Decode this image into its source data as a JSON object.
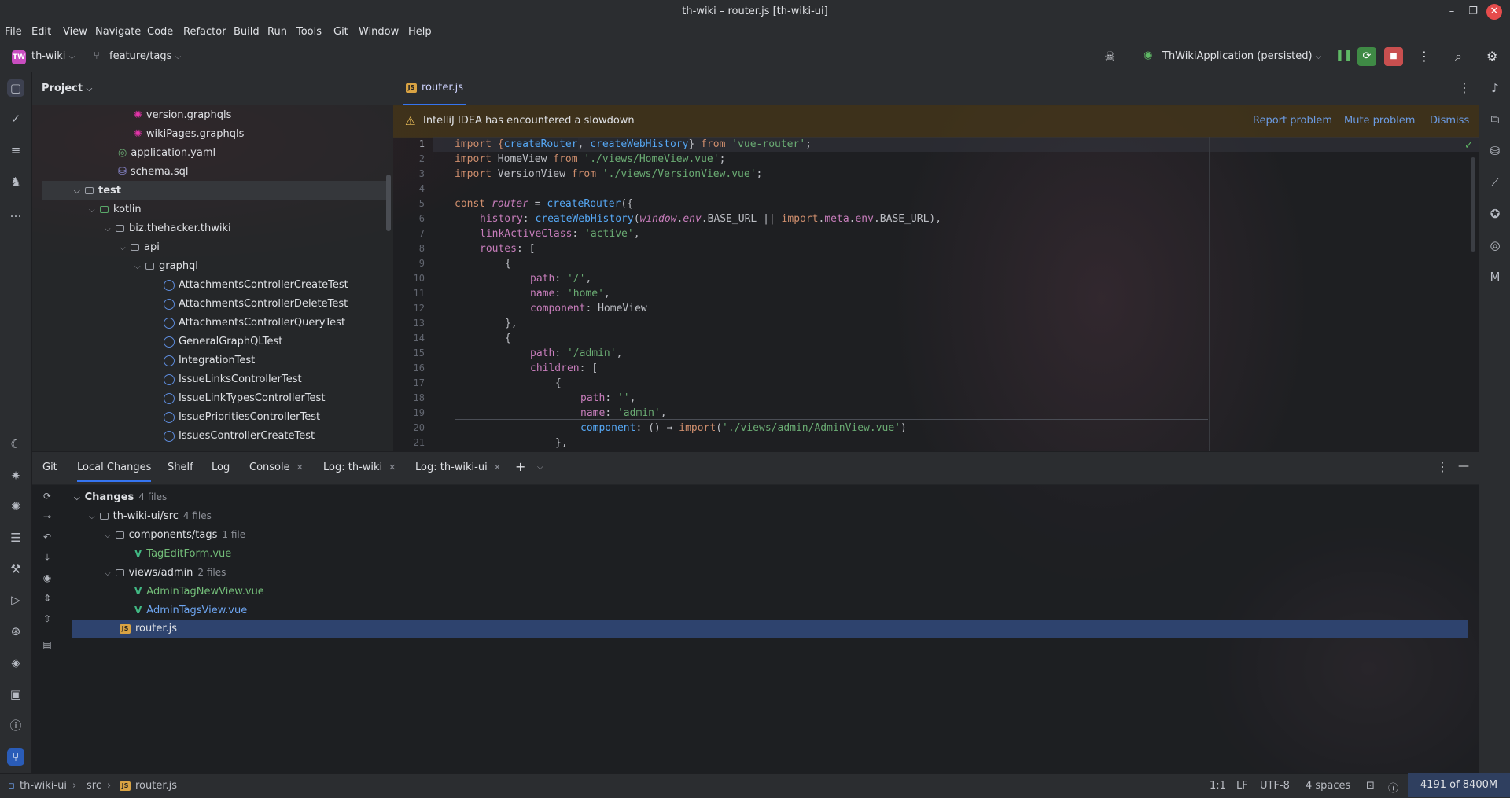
{
  "window": {
    "title": "th-wiki – router.js [th-wiki-ui]"
  },
  "menu": [
    "File",
    "Edit",
    "View",
    "Navigate",
    "Code",
    "Refactor",
    "Build",
    "Run",
    "Tools",
    "Git",
    "Window",
    "Help"
  ],
  "toolbar": {
    "project_badge": "TW",
    "project": "th-wiki",
    "branch": "feature/tags",
    "run_config": "ThWikiApplication (persisted)"
  },
  "project_panel": {
    "title": "Project",
    "tree": [
      {
        "label": "version.graphqls",
        "type": "graphql"
      },
      {
        "label": "wikiPages.graphqls",
        "type": "graphql"
      },
      {
        "label": "application.yaml",
        "type": "yaml"
      },
      {
        "label": "schema.sql",
        "type": "sql"
      },
      {
        "label": "test",
        "type": "folder"
      },
      {
        "label": "kotlin",
        "type": "folder-green"
      },
      {
        "label": "biz.thehacker.thwiki",
        "type": "package"
      },
      {
        "label": "api",
        "type": "package"
      },
      {
        "label": "graphql",
        "type": "package"
      },
      {
        "label": "AttachmentsControllerCreateTest",
        "type": "kotlin"
      },
      {
        "label": "AttachmentsControllerDeleteTest",
        "type": "kotlin"
      },
      {
        "label": "AttachmentsControllerQueryTest",
        "type": "kotlin"
      },
      {
        "label": "GeneralGraphQLTest",
        "type": "kotlin"
      },
      {
        "label": "IntegrationTest",
        "type": "kotlin"
      },
      {
        "label": "IssueLinksControllerTest",
        "type": "kotlin"
      },
      {
        "label": "IssueLinkTypesControllerTest",
        "type": "kotlin"
      },
      {
        "label": "IssuePrioritiesControllerTest",
        "type": "kotlin"
      },
      {
        "label": "IssuesControllerCreateTest",
        "type": "kotlin"
      }
    ]
  },
  "editor": {
    "tab": "router.js",
    "warning": {
      "text": "IntelliJ IDEA has encountered a slowdown",
      "report": "Report problem",
      "mute": "Mute problem",
      "dismiss": "Dismiss"
    },
    "line_numbers": [
      "1",
      "2",
      "3",
      "4",
      "5",
      "6",
      "7",
      "8",
      "9",
      "10",
      "11",
      "12",
      "13",
      "14",
      "15",
      "16",
      "17",
      "18",
      "19",
      "20",
      "21"
    ],
    "code": {
      "l1a": "import {",
      "l1b": "createRouter",
      "l1c": ", ",
      "l1d": "createWebHistory",
      "l1e": "} ",
      "l1f": "from ",
      "l1g": "'vue-router'",
      "l1h": ";",
      "l2a": "import ",
      "l2b": "HomeView ",
      "l2c": "from ",
      "l2d": "'./views/HomeView.vue'",
      "l2e": ";",
      "l3a": "import ",
      "l3b": "VersionView ",
      "l3c": "from ",
      "l3d": "'./views/VersionView.vue'",
      "l3e": ";",
      "l5a": "const ",
      "l5b": "router",
      "l5c": " = ",
      "l5d": "createRouter",
      "l5e": "({",
      "l6a": "history",
      "l6b": ": ",
      "l6c": "createWebHistory",
      "l6d": "(",
      "l6e": "window",
      "l6f": ".",
      "l6g": "env",
      "l6h": ".BASE_URL || ",
      "l6i": "import",
      "l6j": ".",
      "l6k": "meta",
      "l6l": ".",
      "l6m": "env",
      "l6n": ".BASE_URL),",
      "l7a": "linkActiveClass",
      "l7b": ": ",
      "l7c": "'active'",
      "l7d": ",",
      "l8a": "routes",
      "l8b": ": [",
      "l9": "{",
      "l10a": "path",
      "l10b": ": ",
      "l10c": "'/'",
      "l10d": ",",
      "l11a": "name",
      "l11b": ": ",
      "l11c": "'home'",
      "l11d": ",",
      "l12a": "component",
      "l12b": ": HomeView",
      "l13": "},",
      "l14": "{",
      "l15a": "path",
      "l15b": ": ",
      "l15c": "'/admin'",
      "l15d": ",",
      "l16a": "children",
      "l16b": ": [",
      "l17": "{",
      "l18a": "path",
      "l18b": ": ",
      "l18c": "''",
      "l18d": ",",
      "l19a": "name",
      "l19b": ": ",
      "l19c": "'admin'",
      "l19d": ",",
      "l20a": "component",
      "l20b": ": () ⇒ ",
      "l20c": "import",
      "l20d": "(",
      "l20e": "'./views/admin/AdminView.vue'",
      "l20f": ")",
      "l21": "},"
    }
  },
  "bottom_panel": {
    "tabs": [
      "Git",
      "Local Changes",
      "Shelf",
      "Log",
      "Console",
      "Log: th-wiki",
      "Log: th-wiki-ui"
    ],
    "changes": {
      "root": "Changes",
      "root_count": "4 files",
      "dir1": "th-wiki-ui/src",
      "dir1_count": "4 files",
      "dir2": "components/tags",
      "dir2_count": "1 file",
      "file1": "TagEditForm.vue",
      "dir3": "views/admin",
      "dir3_count": "2 files",
      "file2": "AdminTagNewView.vue",
      "file3": "AdminTagsView.vue",
      "file4": "router.js"
    }
  },
  "status_bar": {
    "crumb1": "th-wiki-ui",
    "crumb2": "src",
    "crumb3": "router.js",
    "position": "1:1",
    "line_sep": "LF",
    "encoding": "UTF-8",
    "indent": "4 spaces",
    "memory": "4191 of 8400M"
  }
}
